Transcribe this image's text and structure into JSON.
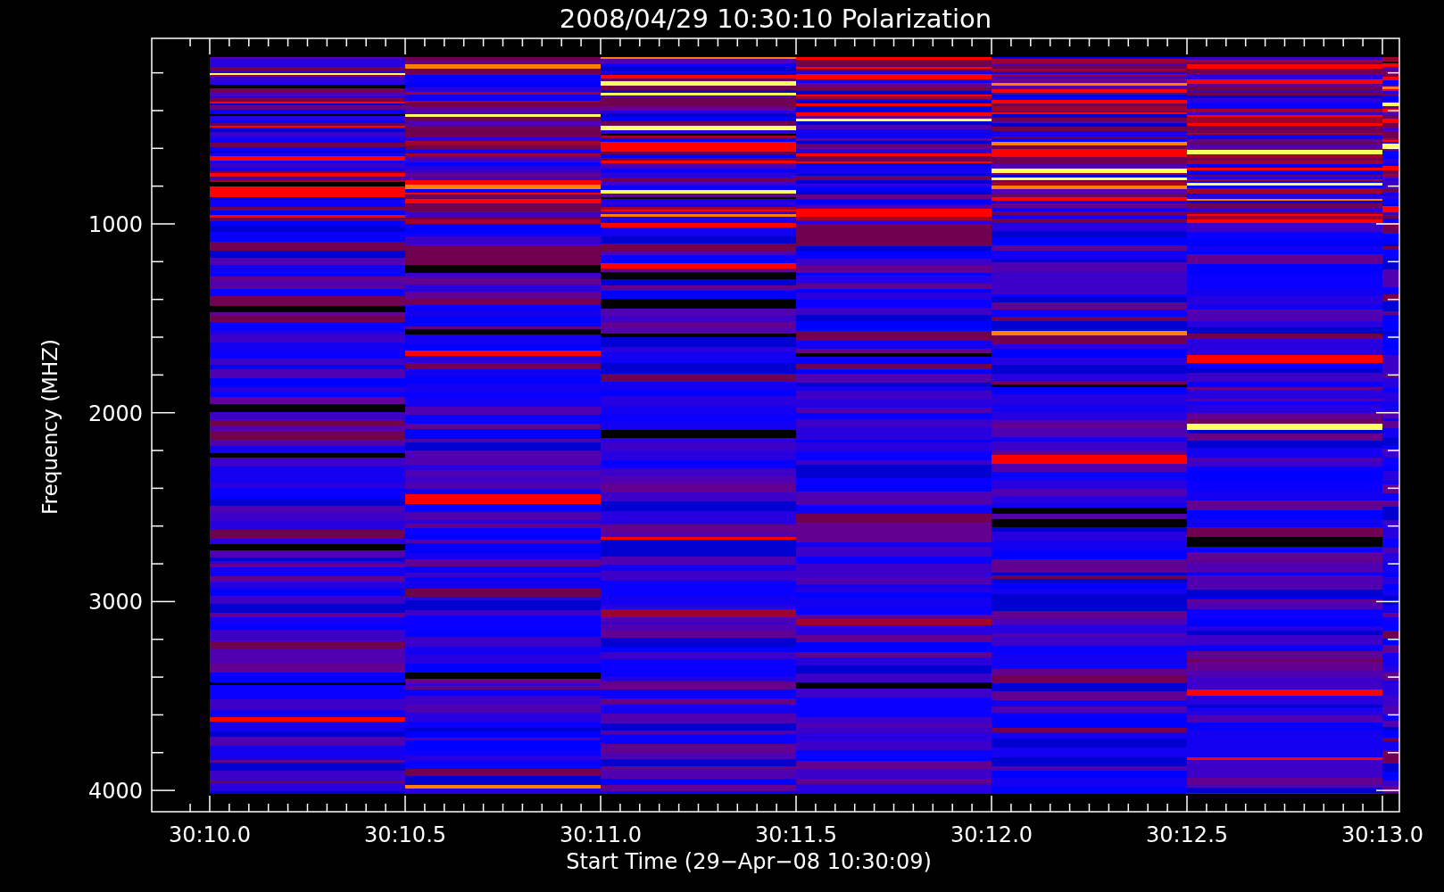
{
  "plot": {
    "title": "2008/04/29 10:30:10 Polarization",
    "ylabel": "Frequency (MHZ)",
    "xlabel": "Start Time (29−Apr−08 10:30:09)",
    "xticks": [
      "30:10.0",
      "30:10.5",
      "30:11.0",
      "30:11.5",
      "30:12.0",
      "30:12.5",
      "30:13.0"
    ],
    "yticks": [
      "1000",
      "2000",
      "3000",
      "4000"
    ]
  }
}
